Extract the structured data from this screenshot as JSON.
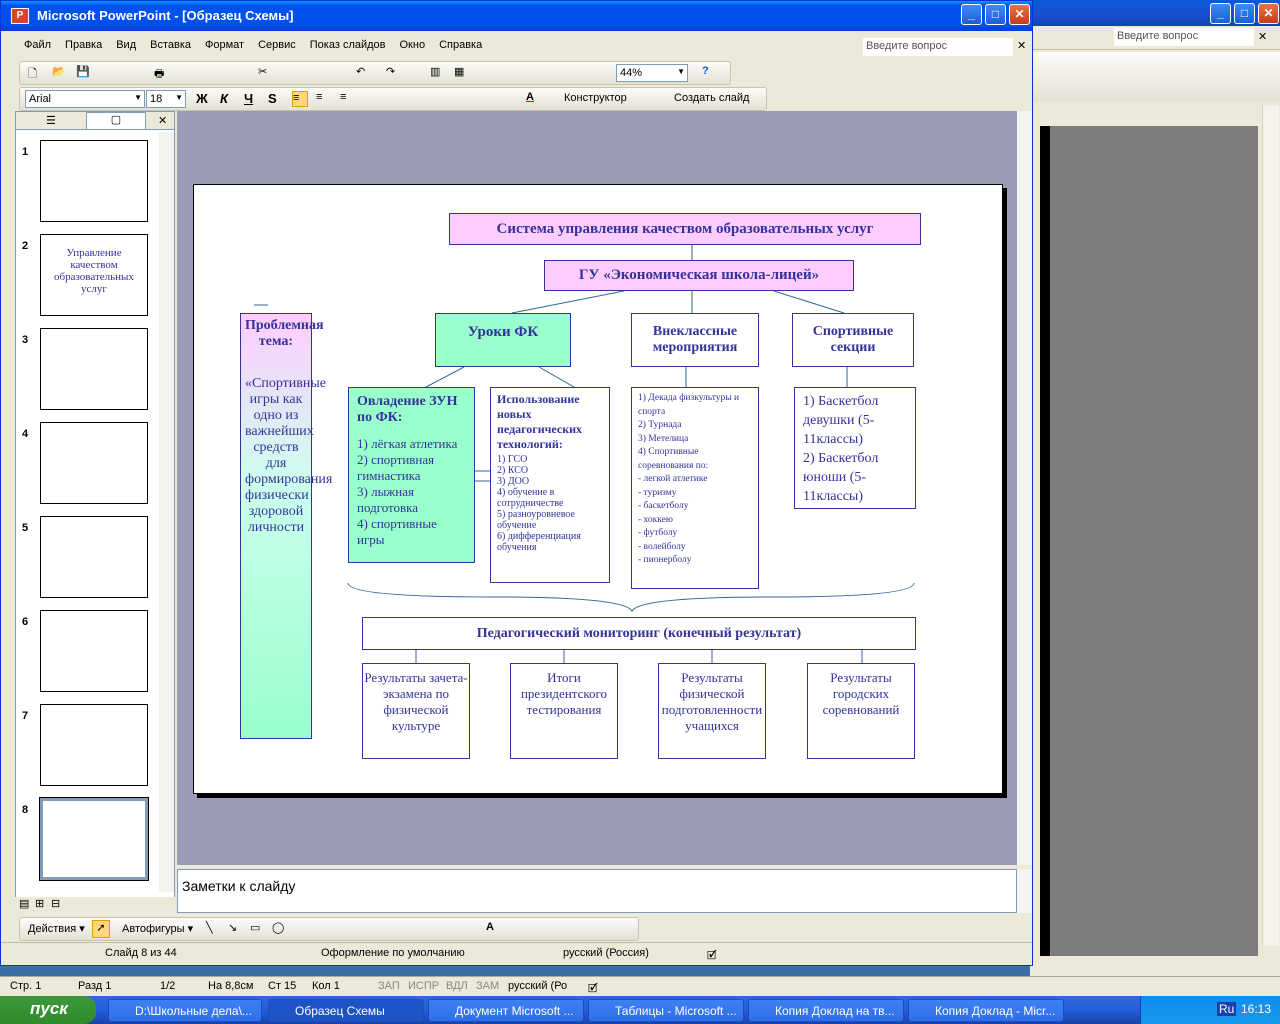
{
  "bg_window": {
    "ask_placeholder": "Введите вопрос"
  },
  "window": {
    "title": "Microsoft PowerPoint - [Образец Схемы]"
  },
  "menu": [
    "Файл",
    "Правка",
    "Вид",
    "Вставка",
    "Формат",
    "Сервис",
    "Показ слайдов",
    "Окно",
    "Справка"
  ],
  "ask_placeholder": "Введите вопрос",
  "toolbar": {
    "zoom": "44%"
  },
  "format_bar": {
    "font": "Arial",
    "size": "18",
    "bold": "Ж",
    "italic": "К",
    "underline": "Ч",
    "shadow": "S",
    "designer": "Конструктор",
    "new_slide": "Создать слайд"
  },
  "slides": [
    {
      "num": "1"
    },
    {
      "num": "2",
      "title": "Управление качеством образовательных услуг"
    },
    {
      "num": "3"
    },
    {
      "num": "4"
    },
    {
      "num": "5"
    },
    {
      "num": "6"
    },
    {
      "num": "7"
    },
    {
      "num": "8"
    }
  ],
  "slide": {
    "top": "Система управления качеством образовательных услуг",
    "school": "ГУ «Экономическая школа-лицей»",
    "lessons": "Уроки ФК",
    "extra": "Внеклассные мероприятия",
    "sections": "Спортивные секции",
    "problem_title": "Проблемная тема:",
    "problem_text": "«Спортивные игры как одно из важнейших средств для формирования физически здоровой личности",
    "zun_title": "Овладение ЗУН по ФК:",
    "zun_items": [
      "1) лёгкая атлетика",
      "2) спортивная гимнастика",
      "3) лыжная подготовка",
      "4) спортивные игры"
    ],
    "tech_title": "Использование новых педагогических технологий:",
    "tech_items": [
      "1) ГСО",
      "2) КСО",
      "3) ДОО",
      "4) обучение в сотрудничестве",
      "5) разноуровневое обучение",
      "6) дифференциация обучения"
    ],
    "events_items": [
      "1) Декада физкультуры и спорта",
      "2) Турнада",
      "3) Метелица",
      "4) Спортивные соревнования по:",
      "- легкой атлетике",
      "- туризму",
      "- баскетболу",
      "- хоккею",
      "- футболу",
      "- волейболу",
      "- пионерболу"
    ],
    "sec_items": [
      "1) Баскетбол девушки (5-11классы)",
      "2) Баскетбол юноши (5-11классы)"
    ],
    "monitoring": "Педагогический мониторинг (конечный результат)",
    "results": [
      "Результаты зачета-экзамена по физической культуре",
      "Итоги президентского тестирования",
      "Результаты физической подготовленности учащихся",
      "Результаты городских соревнований"
    ]
  },
  "notes": "Заметки к слайду",
  "drawing": {
    "actions": "Действия",
    "autoshapes": "Автофигуры"
  },
  "status": {
    "slide": "Слайд 8 из 44",
    "design": "Оформление по умолчанию",
    "lang": "русский (Россия)"
  },
  "word_status": {
    "page": "Стр. 1",
    "section": "Разд 1",
    "pages": "1/2",
    "at": "На 8,8см",
    "line": "Ст 15",
    "col": "Кол 1",
    "rec": "ЗАП",
    "trk": "ИСПР",
    "ext": "ВДЛ",
    "ovr": "ЗАМ",
    "lang": "русский (Ро"
  },
  "taskbar": {
    "start": "пуск",
    "tasks": [
      "D:\\Школьные дела\\...",
      "Образец Схемы",
      "Документ Microsoft ...",
      "Таблицы - Microsoft ...",
      "Копия Доклад на тв...",
      "Копия Доклад - Micr..."
    ],
    "lang": "Ru",
    "time": "16:13"
  }
}
